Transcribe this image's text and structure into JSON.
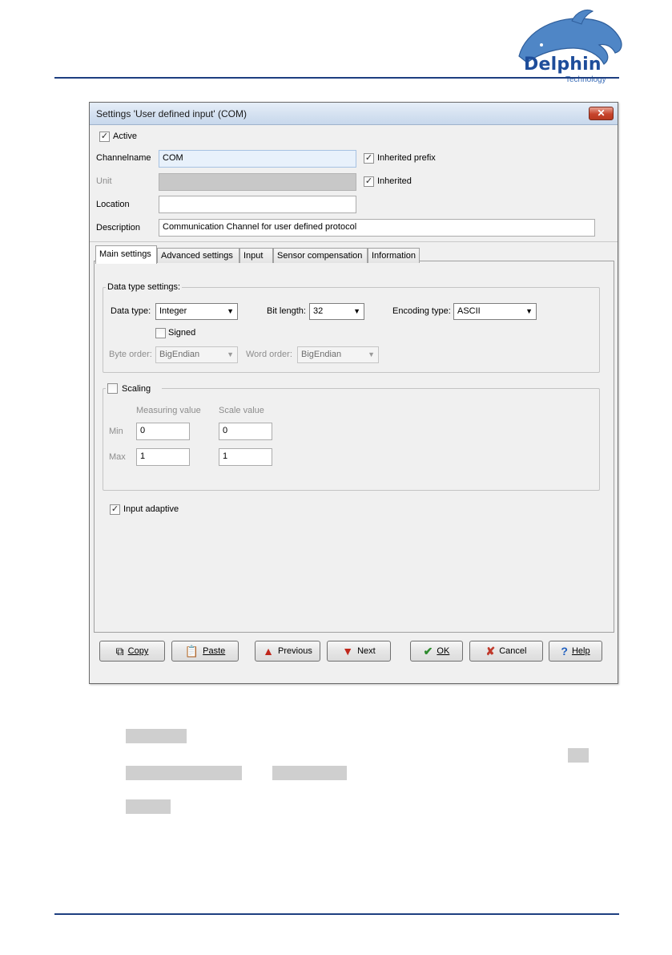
{
  "brand": {
    "name": "Delphin",
    "tagline": "Technology",
    "color": "#1e4d9a"
  },
  "dialog": {
    "title": "Settings 'User defined input' (COM)",
    "close_glyph": "✕",
    "active_label": "Active",
    "active_checked": true,
    "channelname_label": "Channelname",
    "channelname_value": "COM",
    "inherited_prefix_label": "Inherited prefix",
    "inherited_prefix_checked": true,
    "unit_label": "Unit",
    "unit_value": "",
    "inherited_label": "Inherited",
    "inherited_checked": true,
    "location_label": "Location",
    "location_value": "",
    "description_label": "Description",
    "description_value": "Communication Channel for user defined protocol"
  },
  "tabs": [
    {
      "label": "Main settings",
      "active": true
    },
    {
      "label": "Advanced settings",
      "active": false
    },
    {
      "label": "Input",
      "active": false
    },
    {
      "label": "Sensor compensation",
      "active": false
    },
    {
      "label": "Information",
      "active": false
    }
  ],
  "data_type_settings": {
    "group_title": "Data type settings:",
    "data_type_label": "Data type:",
    "data_type_value": "Integer",
    "bit_length_label": "Bit length:",
    "bit_length_value": "32",
    "encoding_type_label": "Encoding type:",
    "encoding_type_value": "ASCII",
    "signed_label": "Signed",
    "signed_checked": false,
    "byte_order_label": "Byte order:",
    "byte_order_value": "BigEndian",
    "word_order_label": "Word order:",
    "word_order_value": "BigEndian"
  },
  "scaling": {
    "label": "Scaling",
    "checked": false,
    "measuring_value_header": "Measuring value",
    "scale_value_header": "Scale value",
    "min_label": "Min",
    "max_label": "Max",
    "min_measuring": "0",
    "min_scale": "0",
    "max_measuring": "1",
    "max_scale": "1"
  },
  "input_adaptive": {
    "label": "Input adaptive",
    "checked": true
  },
  "buttons": {
    "copy": "Copy",
    "paste": "Paste",
    "previous": "Previous",
    "next": "Next",
    "ok": "OK",
    "cancel": "Cancel",
    "help": "Help"
  },
  "icons": {
    "copy": "copy-icon",
    "paste": "paste-icon",
    "previous": "arrow-up-icon",
    "next": "arrow-down-icon",
    "ok": "checkmark-icon",
    "cancel": "x-icon",
    "help": "question-icon"
  },
  "colors": {
    "ok_green": "#2e8b2e",
    "cancel_red": "#c0392b",
    "arrow_red": "#c0271c",
    "help_blue": "#1f5fbf"
  }
}
